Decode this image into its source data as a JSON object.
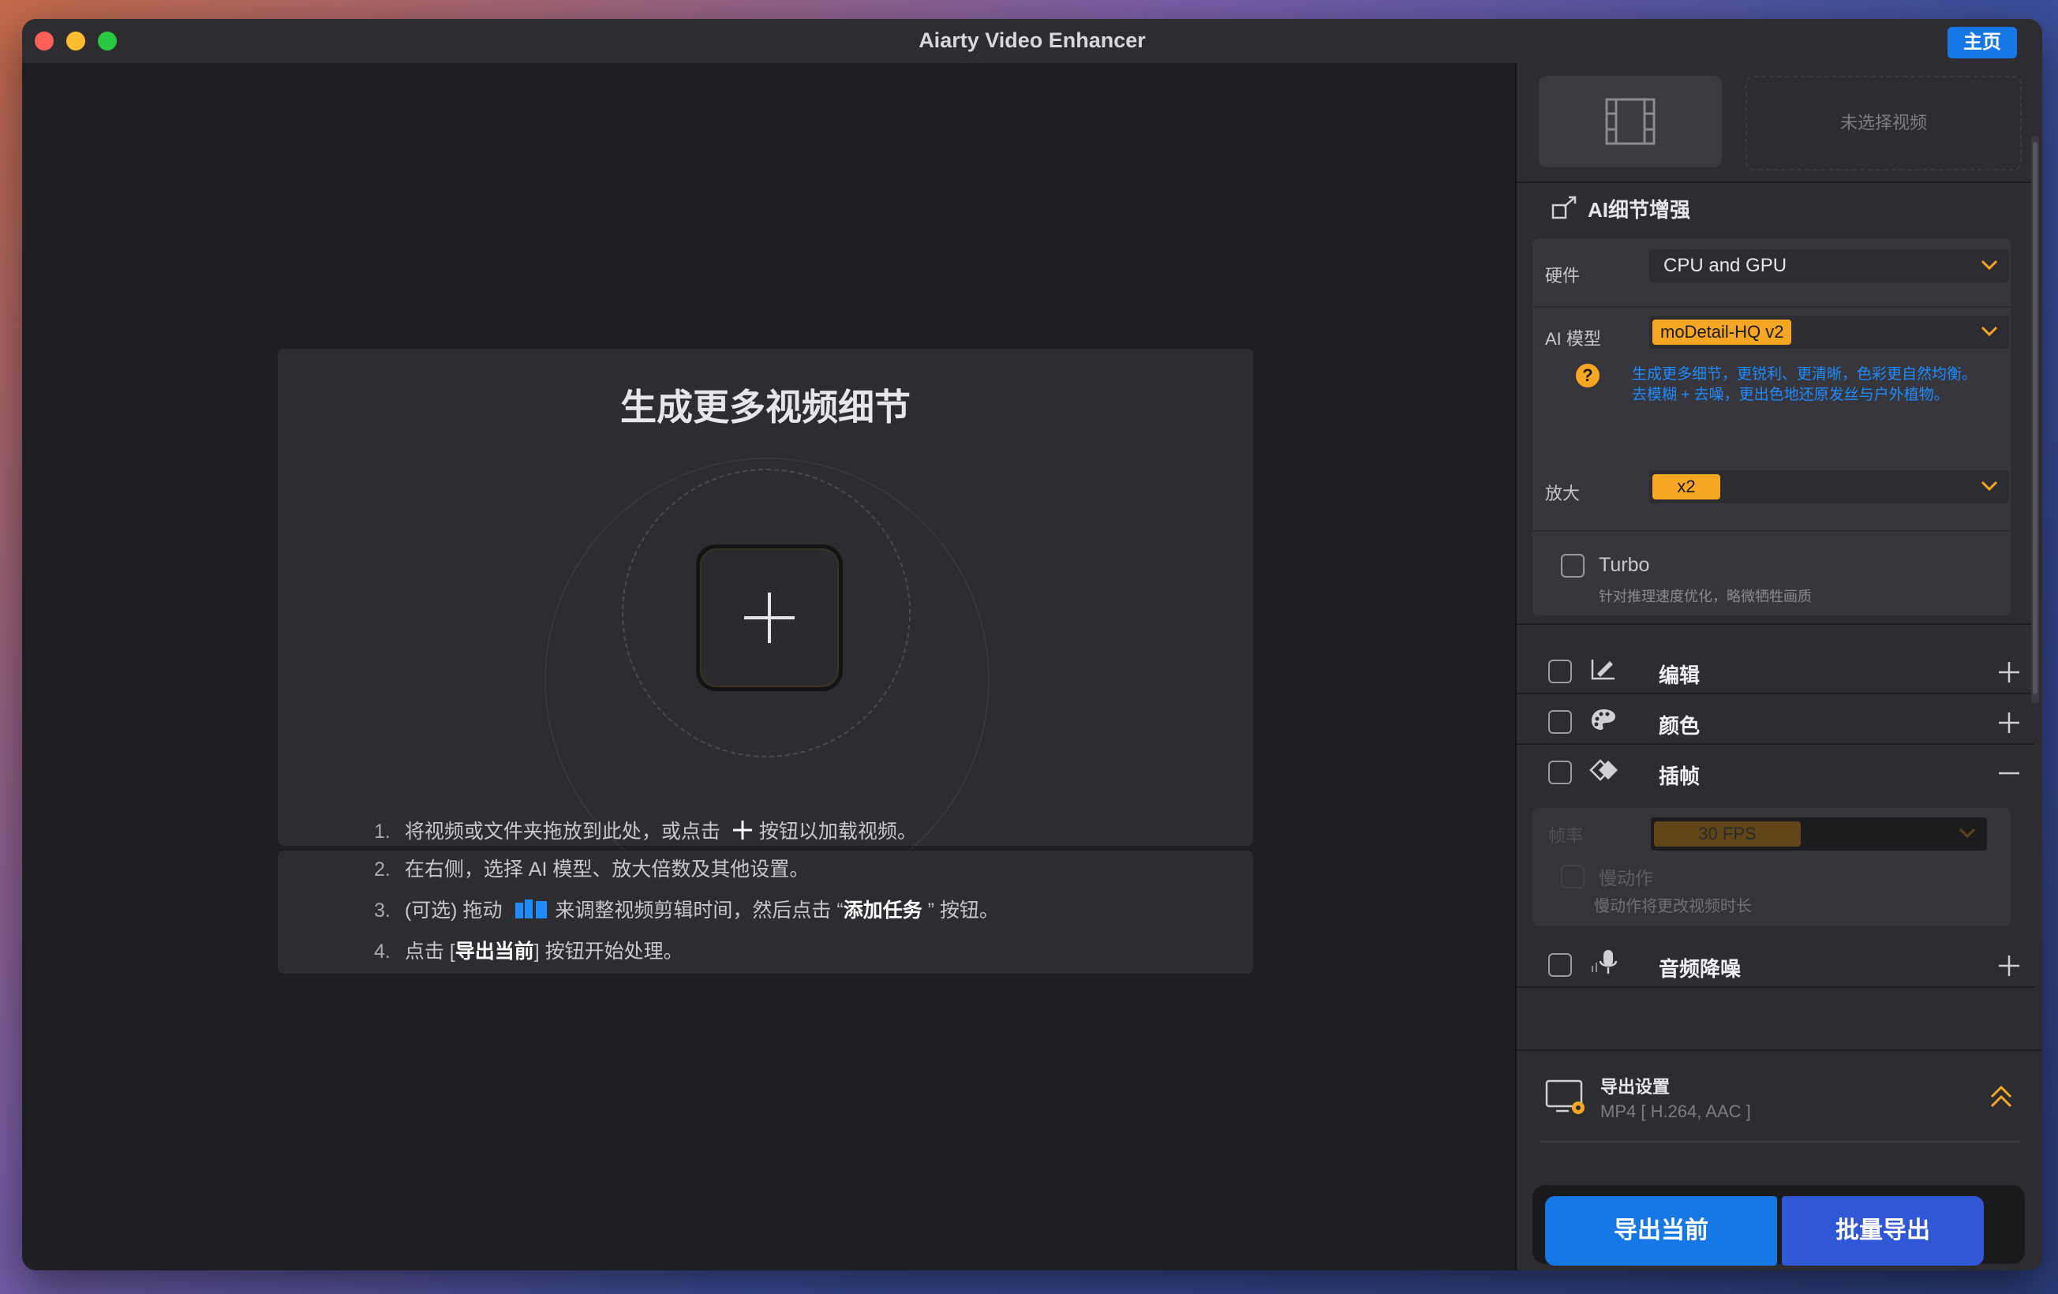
{
  "window": {
    "title": "Aiarty Video Enhancer",
    "home_label": "主页"
  },
  "drop": {
    "title": "生成更多视频细节",
    "steps": [
      {
        "num": "1.",
        "pre": "将视频或文件夹拖放到此处，或点击",
        "post": "按钮以加载视频。"
      },
      {
        "num": "2.",
        "text": "在右侧，选择 AI 模型、放大倍数及其他设置。"
      },
      {
        "num": "3.",
        "pre": "(可选) 拖动",
        "mid": "来调整视频剪辑时间，然后点击 “",
        "bold": "添加任务",
        "post": " ” 按钮。"
      },
      {
        "num": "4.",
        "pre": "点击 [",
        "bold": "导出当前",
        "post": "] 按钮开始处理。"
      }
    ]
  },
  "sidebar": {
    "no_video": "未选择视频",
    "ai_section": "AI细节增强",
    "hardware": {
      "label": "硬件",
      "value": "CPU and GPU"
    },
    "model": {
      "label": "AI 模型",
      "value": "moDetail-HQ  v2",
      "desc_line1": "生成更多细节，更锐利、更清晰，色彩更自然均衡。",
      "desc_line2": "去模糊 + 去噪，更出色地还原发丝与户外植物。"
    },
    "scale": {
      "label": "放大",
      "value": "x2"
    },
    "turbo": {
      "label": "Turbo",
      "desc": "针对推理速度优化，略微牺牲画质"
    },
    "rows": {
      "edit": "编辑",
      "color": "颜色",
      "interp": "插帧",
      "audio": "音频降噪"
    },
    "interp_panel": {
      "fps_label": "帧率",
      "fps_value": "30 FPS",
      "slowmo_label": "慢动作",
      "slowmo_desc": "慢动作将更改视频时长"
    },
    "export": {
      "title": "导出设置",
      "format": "MP4 [ H.264, AAC ]",
      "current_btn": "导出当前",
      "batch_btn": "批量导出"
    }
  },
  "colors": {
    "accent": "#1677e6",
    "badge": "#f5a623",
    "info_text": "#1e8cff"
  }
}
